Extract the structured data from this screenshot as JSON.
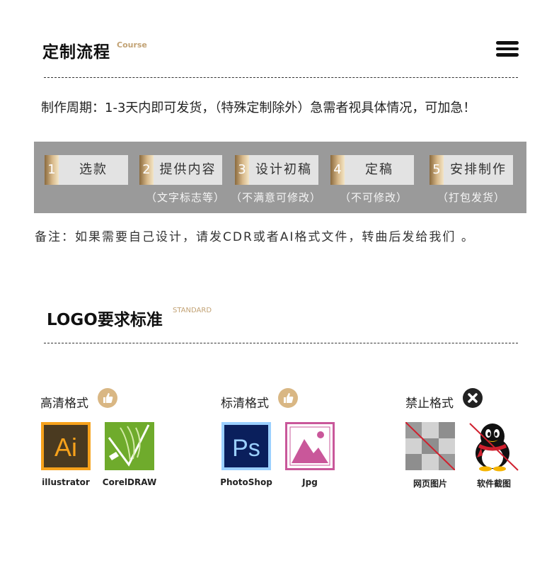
{
  "section1": {
    "title": "定制流程",
    "subtitle": "Course",
    "period_text": "制作周期：1-3天内即可发货，（特殊定制除外）急需者视具体情况，可加急！",
    "steps": [
      {
        "num": "1",
        "label": "选款",
        "note": ""
      },
      {
        "num": "2",
        "label": "提供内容",
        "note": "（文字标志等）"
      },
      {
        "num": "3",
        "label": "设计初稿",
        "note": "（不满意可修改）"
      },
      {
        "num": "4",
        "label": "定稿",
        "note": "（不可修改）"
      },
      {
        "num": "5",
        "label": "安排制作",
        "note": "（打包发货）"
      }
    ],
    "remark": "备注：如果需要自己设计，请发CDR或者AI格式文件，转曲后发给我们 。"
  },
  "section2": {
    "title": "LOGO要求标准",
    "subtitle": "STANDARD",
    "groups": [
      {
        "title": "高清格式",
        "icon": "thumbs-up-icon",
        "items": [
          {
            "caption": "illustrator",
            "icon": "illustrator-icon",
            "glyph": "Ai"
          },
          {
            "caption": "CorelDRAW",
            "icon": "coreldraw-icon"
          }
        ]
      },
      {
        "title": "标清格式",
        "icon": "thumbs-up-icon",
        "items": [
          {
            "caption": "PhotoShop",
            "icon": "photoshop-icon",
            "glyph": "Ps"
          },
          {
            "caption": "Jpg",
            "icon": "jpg-image-icon"
          }
        ]
      },
      {
        "title": "禁止格式",
        "icon": "forbidden-x-icon",
        "items": [
          {
            "caption": "网页图片",
            "icon": "web-image-icon"
          },
          {
            "caption": "软件截图",
            "icon": "qq-penguin-icon"
          }
        ]
      }
    ]
  },
  "colors": {
    "gold": "#c2a274",
    "banner_gray": "#9a9a9a",
    "step_bg": "#e3e3e3",
    "ai_bg": "#4a3a20",
    "ai_orange": "#f7a21b",
    "corel_green": "#6fab2c",
    "ps_bg": "#0a1f5c",
    "ps_blue": "#9bd0ff",
    "jpg_pink": "#c9579a",
    "forbid_red": "#d0202e"
  }
}
